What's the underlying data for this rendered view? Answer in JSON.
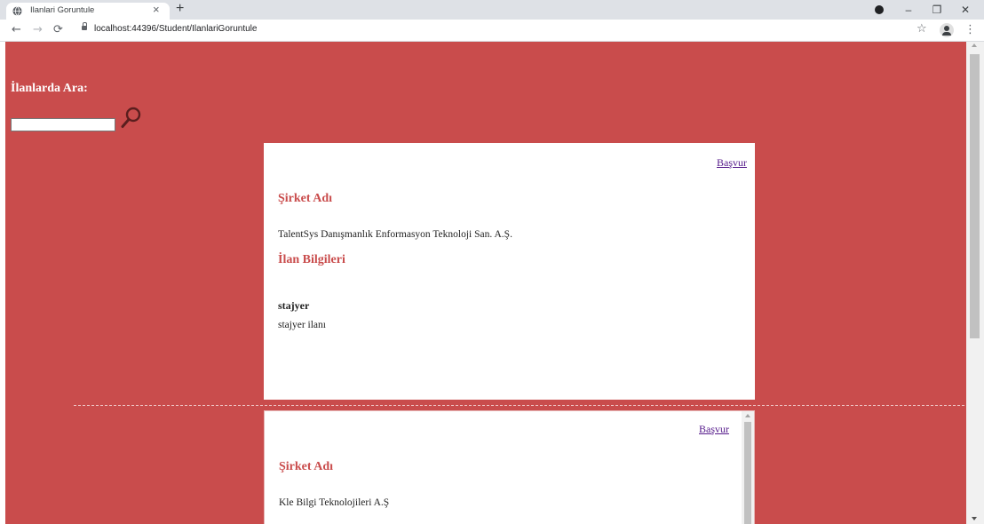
{
  "browser": {
    "tab_title": "Ilanlari Goruntule",
    "tab_close": "×",
    "new_tab": "+",
    "url": "localhost:44396/Student/IlanlariGoruntule",
    "controls": {
      "minimize": "–",
      "restore": "❐",
      "close": "✕"
    }
  },
  "search": {
    "heading": "İlanlarda Ara:",
    "value": ""
  },
  "listings": [
    {
      "apply_label": "Başvur",
      "company_heading": "Şirket Adı",
      "company_name": "TalentSys Danışmanlık Enformasyon Teknoloji San. A.Ş.",
      "info_heading": "İlan Bilgileri",
      "position": "stajyer",
      "description": "stajyer ilanı"
    },
    {
      "apply_label": "Başvur",
      "company_heading": "Şirket Adı",
      "company_name": "Kle Bilgi Teknolojileri A.Ş"
    }
  ],
  "colors": {
    "page_background": "#c94c4c",
    "heading_accent": "#c94c4c",
    "link": "#551a8b"
  }
}
